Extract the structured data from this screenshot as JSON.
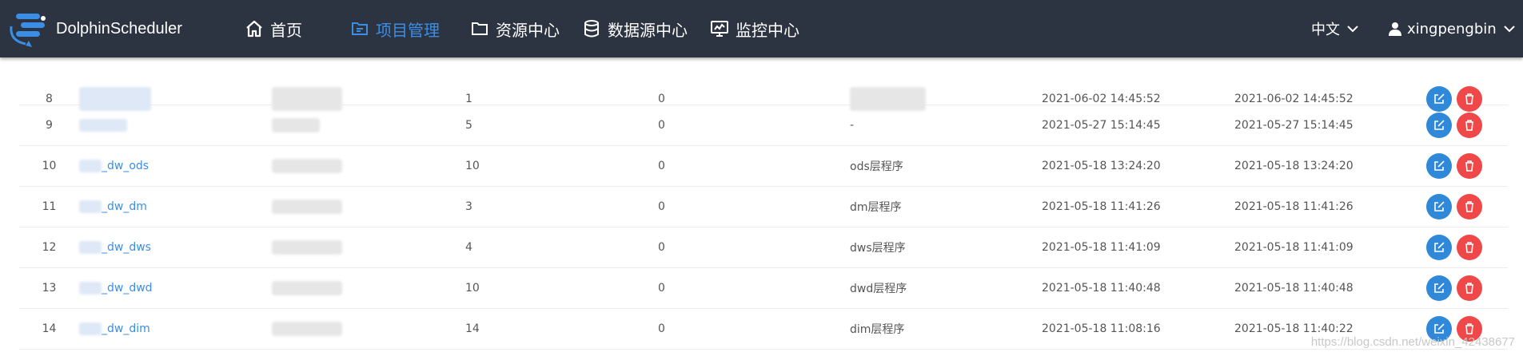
{
  "app": {
    "name": "DolphinScheduler"
  },
  "nav": [
    {
      "label": "首页",
      "icon": "home-icon",
      "active": false
    },
    {
      "label": "项目管理",
      "icon": "project-icon",
      "active": true
    },
    {
      "label": "资源中心",
      "icon": "folder-icon",
      "active": false
    },
    {
      "label": "数据源中心",
      "icon": "database-icon",
      "active": false
    },
    {
      "label": "监控中心",
      "icon": "monitor-icon",
      "active": false
    }
  ],
  "lang": {
    "label": "中文"
  },
  "user": {
    "name": "xingpengbin"
  },
  "rows": [
    {
      "no": "8",
      "name_suffix": "",
      "workflows": "1",
      "running": "0",
      "desc": "",
      "created": "2021-06-02 14:45:52",
      "updated": "2021-06-02 14:45:52"
    },
    {
      "no": "9",
      "name_suffix": "",
      "workflows": "5",
      "running": "0",
      "desc": "-",
      "created": "2021-05-27 15:14:45",
      "updated": "2021-05-27 15:14:45"
    },
    {
      "no": "10",
      "name_suffix": "_dw_ods",
      "workflows": "10",
      "running": "0",
      "desc": "ods层程序",
      "created": "2021-05-18 13:24:20",
      "updated": "2021-05-18 13:24:20"
    },
    {
      "no": "11",
      "name_suffix": "_dw_dm",
      "workflows": "3",
      "running": "0",
      "desc": "dm层程序",
      "created": "2021-05-18 11:41:26",
      "updated": "2021-05-18 11:41:26"
    },
    {
      "no": "12",
      "name_suffix": "_dw_dws",
      "workflows": "4",
      "running": "0",
      "desc": "dws层程序",
      "created": "2021-05-18 11:41:09",
      "updated": "2021-05-18 11:41:09"
    },
    {
      "no": "13",
      "name_suffix": "_dw_dwd",
      "workflows": "10",
      "running": "0",
      "desc": "dwd层程序",
      "created": "2021-05-18 11:40:48",
      "updated": "2021-05-18 11:40:48"
    },
    {
      "no": "14",
      "name_suffix": "_dw_dim",
      "workflows": "14",
      "running": "0",
      "desc": "dim层程序",
      "created": "2021-05-18 11:08:16",
      "updated": "2021-05-18 11:40:22"
    }
  ],
  "watermark": "https://blog.csdn.net/weixin_42438677",
  "colors": {
    "header": "#2c3341",
    "accent": "#3a8ee6",
    "edit": "#2f89d8",
    "delete": "#f04848"
  }
}
